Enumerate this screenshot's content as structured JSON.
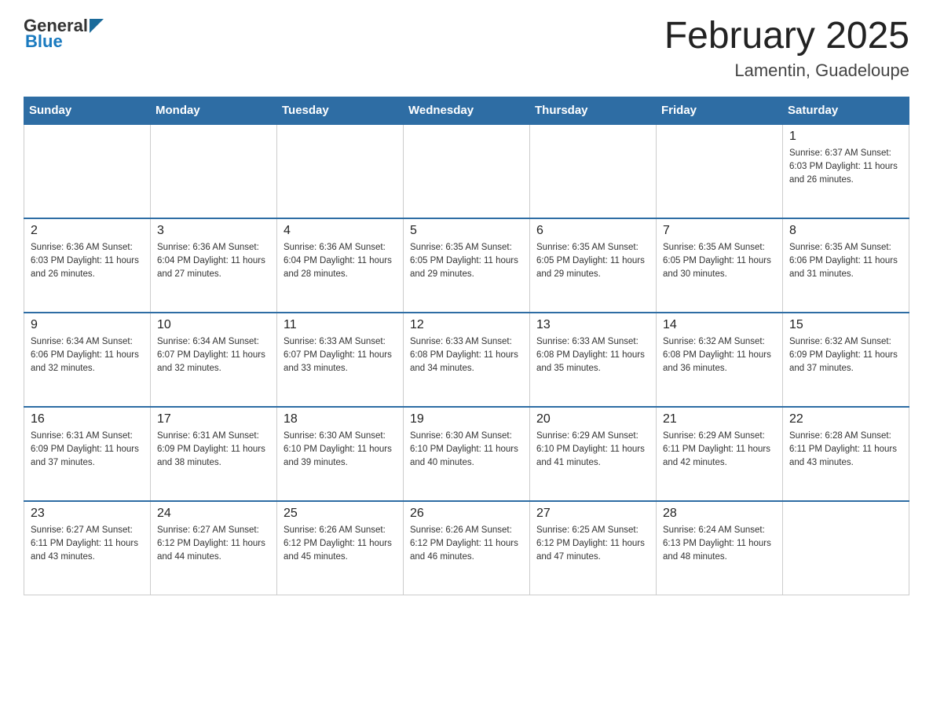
{
  "header": {
    "logo_general": "General",
    "logo_blue": "Blue",
    "month_title": "February 2025",
    "location": "Lamentin, Guadeloupe"
  },
  "weekdays": [
    "Sunday",
    "Monday",
    "Tuesday",
    "Wednesday",
    "Thursday",
    "Friday",
    "Saturday"
  ],
  "weeks": [
    [
      {
        "day": "",
        "info": ""
      },
      {
        "day": "",
        "info": ""
      },
      {
        "day": "",
        "info": ""
      },
      {
        "day": "",
        "info": ""
      },
      {
        "day": "",
        "info": ""
      },
      {
        "day": "",
        "info": ""
      },
      {
        "day": "1",
        "info": "Sunrise: 6:37 AM\nSunset: 6:03 PM\nDaylight: 11 hours\nand 26 minutes."
      }
    ],
    [
      {
        "day": "2",
        "info": "Sunrise: 6:36 AM\nSunset: 6:03 PM\nDaylight: 11 hours\nand 26 minutes."
      },
      {
        "day": "3",
        "info": "Sunrise: 6:36 AM\nSunset: 6:04 PM\nDaylight: 11 hours\nand 27 minutes."
      },
      {
        "day": "4",
        "info": "Sunrise: 6:36 AM\nSunset: 6:04 PM\nDaylight: 11 hours\nand 28 minutes."
      },
      {
        "day": "5",
        "info": "Sunrise: 6:35 AM\nSunset: 6:05 PM\nDaylight: 11 hours\nand 29 minutes."
      },
      {
        "day": "6",
        "info": "Sunrise: 6:35 AM\nSunset: 6:05 PM\nDaylight: 11 hours\nand 29 minutes."
      },
      {
        "day": "7",
        "info": "Sunrise: 6:35 AM\nSunset: 6:05 PM\nDaylight: 11 hours\nand 30 minutes."
      },
      {
        "day": "8",
        "info": "Sunrise: 6:35 AM\nSunset: 6:06 PM\nDaylight: 11 hours\nand 31 minutes."
      }
    ],
    [
      {
        "day": "9",
        "info": "Sunrise: 6:34 AM\nSunset: 6:06 PM\nDaylight: 11 hours\nand 32 minutes."
      },
      {
        "day": "10",
        "info": "Sunrise: 6:34 AM\nSunset: 6:07 PM\nDaylight: 11 hours\nand 32 minutes."
      },
      {
        "day": "11",
        "info": "Sunrise: 6:33 AM\nSunset: 6:07 PM\nDaylight: 11 hours\nand 33 minutes."
      },
      {
        "day": "12",
        "info": "Sunrise: 6:33 AM\nSunset: 6:08 PM\nDaylight: 11 hours\nand 34 minutes."
      },
      {
        "day": "13",
        "info": "Sunrise: 6:33 AM\nSunset: 6:08 PM\nDaylight: 11 hours\nand 35 minutes."
      },
      {
        "day": "14",
        "info": "Sunrise: 6:32 AM\nSunset: 6:08 PM\nDaylight: 11 hours\nand 36 minutes."
      },
      {
        "day": "15",
        "info": "Sunrise: 6:32 AM\nSunset: 6:09 PM\nDaylight: 11 hours\nand 37 minutes."
      }
    ],
    [
      {
        "day": "16",
        "info": "Sunrise: 6:31 AM\nSunset: 6:09 PM\nDaylight: 11 hours\nand 37 minutes."
      },
      {
        "day": "17",
        "info": "Sunrise: 6:31 AM\nSunset: 6:09 PM\nDaylight: 11 hours\nand 38 minutes."
      },
      {
        "day": "18",
        "info": "Sunrise: 6:30 AM\nSunset: 6:10 PM\nDaylight: 11 hours\nand 39 minutes."
      },
      {
        "day": "19",
        "info": "Sunrise: 6:30 AM\nSunset: 6:10 PM\nDaylight: 11 hours\nand 40 minutes."
      },
      {
        "day": "20",
        "info": "Sunrise: 6:29 AM\nSunset: 6:10 PM\nDaylight: 11 hours\nand 41 minutes."
      },
      {
        "day": "21",
        "info": "Sunrise: 6:29 AM\nSunset: 6:11 PM\nDaylight: 11 hours\nand 42 minutes."
      },
      {
        "day": "22",
        "info": "Sunrise: 6:28 AM\nSunset: 6:11 PM\nDaylight: 11 hours\nand 43 minutes."
      }
    ],
    [
      {
        "day": "23",
        "info": "Sunrise: 6:27 AM\nSunset: 6:11 PM\nDaylight: 11 hours\nand 43 minutes."
      },
      {
        "day": "24",
        "info": "Sunrise: 6:27 AM\nSunset: 6:12 PM\nDaylight: 11 hours\nand 44 minutes."
      },
      {
        "day": "25",
        "info": "Sunrise: 6:26 AM\nSunset: 6:12 PM\nDaylight: 11 hours\nand 45 minutes."
      },
      {
        "day": "26",
        "info": "Sunrise: 6:26 AM\nSunset: 6:12 PM\nDaylight: 11 hours\nand 46 minutes."
      },
      {
        "day": "27",
        "info": "Sunrise: 6:25 AM\nSunset: 6:12 PM\nDaylight: 11 hours\nand 47 minutes."
      },
      {
        "day": "28",
        "info": "Sunrise: 6:24 AM\nSunset: 6:13 PM\nDaylight: 11 hours\nand 48 minutes."
      },
      {
        "day": "",
        "info": ""
      }
    ]
  ]
}
